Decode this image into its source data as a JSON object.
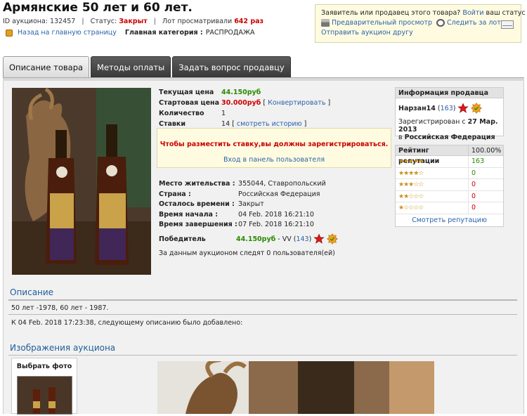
{
  "header": {
    "title": "Армянские 50 лет и 60 лет.",
    "id_label": "ID аукциона:",
    "id_value": "132457",
    "status_label": "Статус:",
    "status_value": "Закрыт",
    "views_label": "Лот просматривали",
    "views_value": "642 раз",
    "back_link": "Назад на главную страницу",
    "category_label": "Главная категория :",
    "category_value": "РАСПРОДАЖА"
  },
  "infobox": {
    "text": "Заявитель или продавец этого товара?",
    "login_link": "Войти",
    "suffix": "ваш статус",
    "preview_link": "Предварительный просмотр",
    "watch_link": "Следить за лотом",
    "send_link": "Отправить аукцион другу"
  },
  "tabs": [
    "Описание товара",
    "Методы оплаты",
    "Задать вопрос продавцу"
  ],
  "bid_info": {
    "current_label": "Текущая цена",
    "current_value": "44.150руб",
    "start_label": "Стартовая цена",
    "start_value": "30.000руб",
    "convert_link": "Конвертировать",
    "qty_label": "Количество",
    "qty_value": "1",
    "bids_label": "Ставки",
    "bids_value": "14",
    "history_link": "смотреть историю"
  },
  "warning": {
    "message": "Чтобы разместить ставку,вы должны зарегистрироваться.",
    "login_link": "Вход в панель пользователя"
  },
  "lot_info": {
    "location_label": "Место жительства",
    "location_value": "355044, Ставропольский",
    "country_label": "Страна",
    "country_value": "Российская Федерация",
    "timeleft_label": "Осталось времени",
    "timeleft_value": "Закрыт",
    "start_label": "Время начала",
    "start_value": "04 Feb. 2018 16:21:10",
    "end_label": "Время завершения",
    "end_value": "07 Feb. 2018 16:21:10",
    "winner_label": "Победитель",
    "winner_price": "44.150руб",
    "winner_name": "VV",
    "winner_rating": "143",
    "watchers": "За данным аукционом следят 0 пользователя(ей)"
  },
  "seller": {
    "header": "Информация продавца",
    "name": "Нарзан14",
    "rating": "163",
    "registered_prefix": "Зарегистрирован с",
    "registered_date": "27 Мар. 2013",
    "registered_in": "в",
    "registered_country": "Российская Федерация"
  },
  "reputation": {
    "header_label": "Рейтинг репутации",
    "header_value": "100.00%",
    "rows": [
      {
        "stars": "★★★★★",
        "value": "163",
        "color": "#2a8a00"
      },
      {
        "stars": "★★★★☆",
        "value": "0",
        "color": "#2a8a00"
      },
      {
        "stars": "★★★☆☆",
        "value": "0",
        "color": "#cc0000"
      },
      {
        "stars": "★★☆☆☆",
        "value": "0",
        "color": "#cc0000"
      },
      {
        "stars": "★☆☆☆☆",
        "value": "0",
        "color": "#cc0000"
      }
    ],
    "footer_link": "Смотреть репутацию"
  },
  "description": {
    "heading": "Описание",
    "text": "50 лет -1978, 60 лет - 1987.",
    "added": "К 04 Feb. 2018 17:23:38, следующему описанию было добавлено:"
  },
  "images": {
    "heading": "Изображения аукциона",
    "choose_label": "Выбрать фото"
  }
}
